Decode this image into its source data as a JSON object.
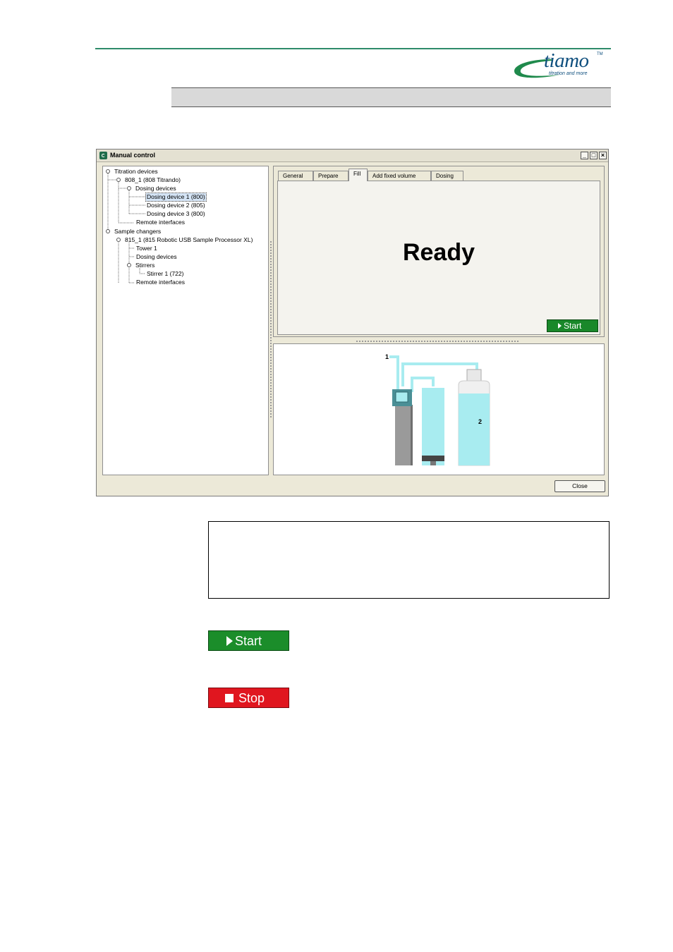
{
  "logo": {
    "word": "tiamo",
    "tm": "TM",
    "tagline": "titration and more"
  },
  "window": {
    "title": "Manual control",
    "controls": {
      "minimize": "_",
      "maximize": "□",
      "close": "×"
    },
    "tree": {
      "nodes": [
        "Titration devices",
        "808_1 (808 Titrando)",
        "Dosing devices",
        "Dosing device 1 (800)",
        "Dosing device 2 (805)",
        "Dosing device 3 (800)",
        "Remote interfaces",
        "Sample changers",
        "815_1 (815 Robotic USB Sample Processor XL)",
        "Tower 1",
        "Dosing devices",
        "Stirrers",
        "Stirrer 1 (722)",
        "Remote interfaces"
      ],
      "selected_index": 3
    },
    "tabs": [
      "General",
      "Prepare",
      "Fill",
      "Add fixed volume",
      "Dosing"
    ],
    "active_tab": "Fill",
    "status": "Ready",
    "start_label": "Start",
    "diagram": {
      "label_1": "1",
      "label_2": "2"
    },
    "close_label": "Close"
  },
  "buttons": {
    "start_label": "Start",
    "stop_label": "Stop"
  },
  "colors": {
    "accent_green": "#1b8d2a",
    "stop_red": "#e0161f",
    "brand_blue": "#0f4f7e",
    "liquid": "#a8ecf0"
  }
}
